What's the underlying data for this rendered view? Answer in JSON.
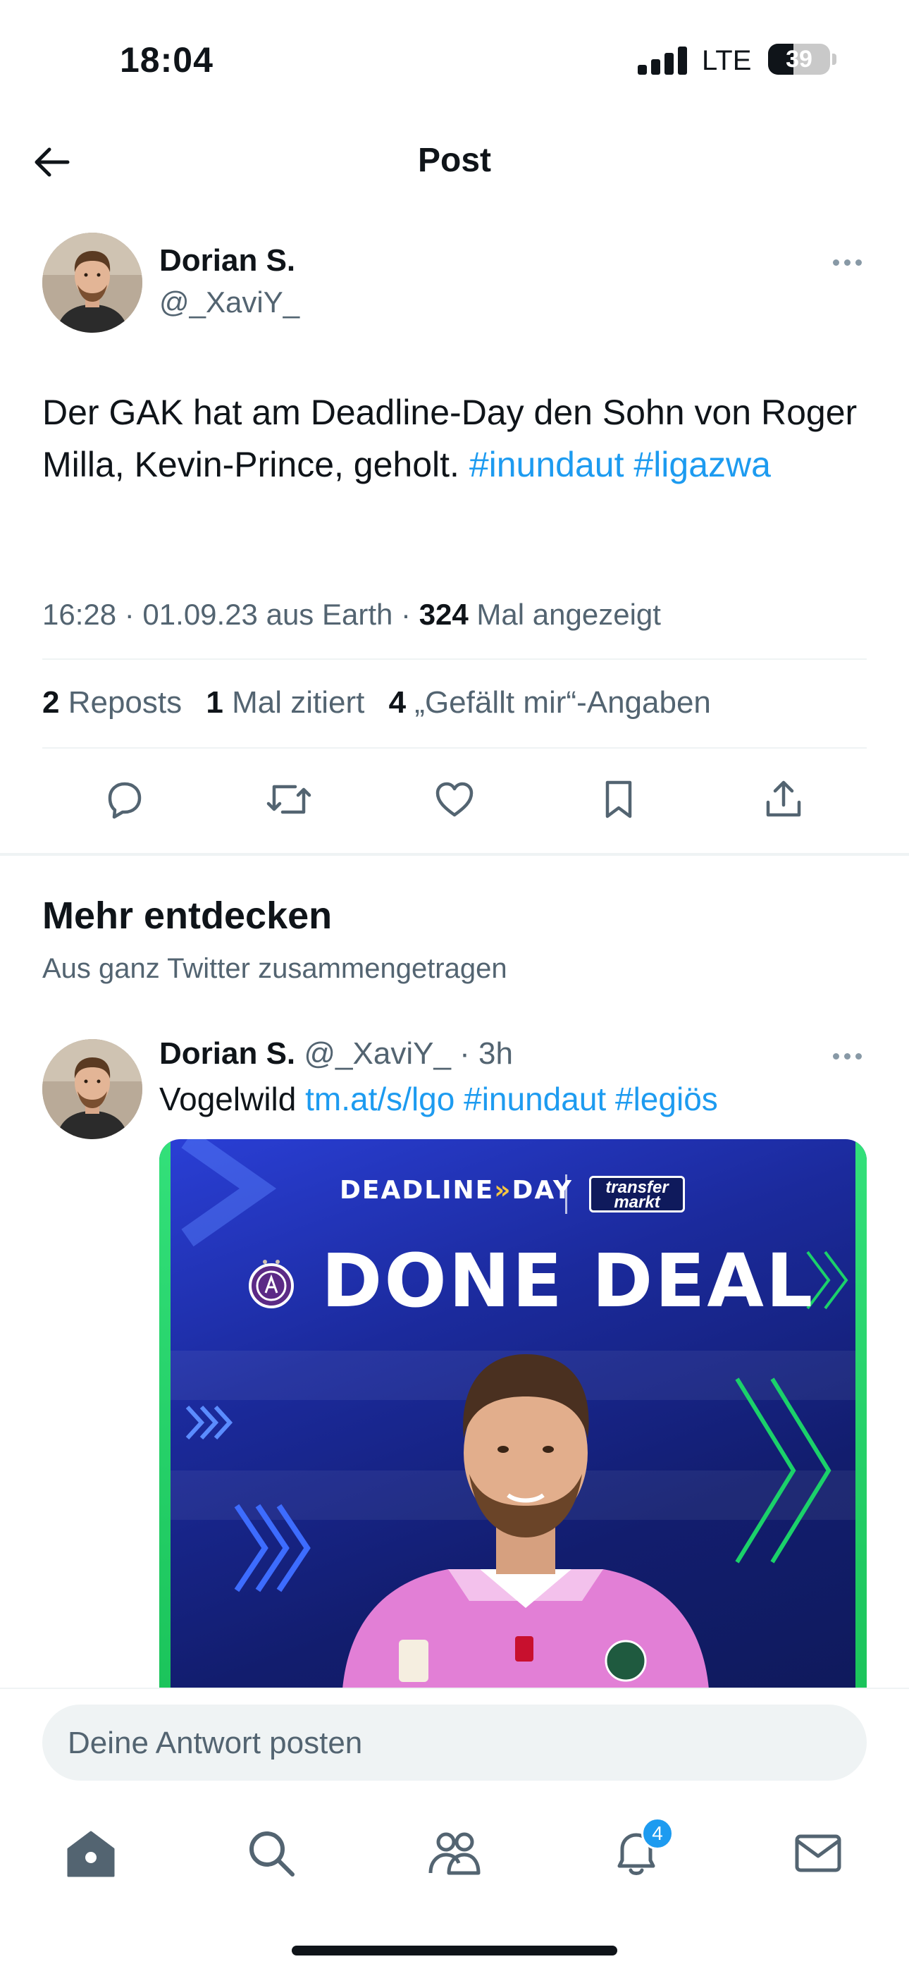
{
  "status_bar": {
    "time": "18:04",
    "network": "LTE",
    "battery": "39"
  },
  "header": {
    "title": "Post"
  },
  "post": {
    "author_name": "Dorian S.",
    "author_handle": "@_XaviY_",
    "text_plain": "Der GAK hat am Deadline-Day den Sohn von Roger Milla, Kevin-Prince, geholt.",
    "hashtags": [
      "#inundaut",
      "#ligazwa"
    ],
    "timestamp": "16:28 · 01.09.23 aus Earth · ",
    "view_count": "324",
    "view_label": " Mal angezeigt",
    "stats": {
      "reposts_count": "2",
      "reposts_label": "Reposts",
      "quotes_count": "1",
      "quotes_label": "Mal zitiert",
      "likes_count": "4",
      "likes_label": "„Gefällt mir“-Angaben"
    },
    "actions": [
      "reply-icon",
      "repost-icon",
      "like-icon",
      "bookmark-icon",
      "share-icon"
    ]
  },
  "discover": {
    "title": "Mehr entdecken",
    "subtitle": "Aus ganz Twitter zusammengetragen"
  },
  "related_tweet": {
    "author_name": "Dorian S.",
    "author_handle": "@_XaviY_",
    "time": " · 3h",
    "text_plain": "Vogelwild ",
    "link": "tm.at/s/lgo",
    "hashtags": [
      "#inundaut",
      "#legiös"
    ],
    "media": {
      "deadline_word1": "DEADLINE",
      "deadline_arrows": "»",
      "deadline_word2": "DAY",
      "partner_line1": "transfer",
      "partner_line2": "markt",
      "headline": "DONE DEAL"
    }
  },
  "reply": {
    "placeholder": "Deine Antwort posten"
  },
  "tabbar": {
    "tabs": [
      "home-icon",
      "search-icon",
      "communities-icon",
      "notifications-icon",
      "messages-icon"
    ],
    "notifications_badge": "4"
  },
  "colors": {
    "accent": "#1d9bf0",
    "text": "#0f1419",
    "muted": "#536471",
    "divider": "#eff3f4"
  }
}
